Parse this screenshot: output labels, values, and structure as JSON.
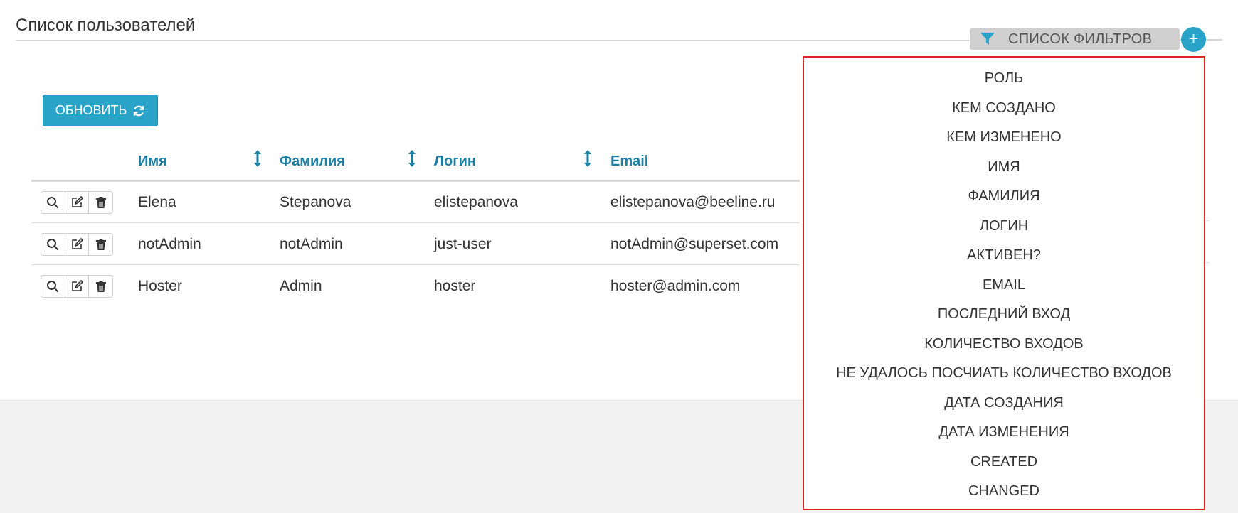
{
  "page": {
    "title": "Список пользователей"
  },
  "toolbar": {
    "refresh_label": "ОБНОВИТЬ"
  },
  "table": {
    "columns": [
      "Имя",
      "Фамилия",
      "Логин",
      "Email"
    ],
    "rows": [
      {
        "first_name": "Elena",
        "last_name": "Stepanova",
        "login": "elistepanova",
        "email": "elistepanova@beeline.ru"
      },
      {
        "first_name": "notAdmin",
        "last_name": "notAdmin",
        "login": "just-user",
        "email": "notAdmin@superset.com"
      },
      {
        "first_name": "Hoster",
        "last_name": "Admin",
        "login": "hoster",
        "email": "hoster@admin.com"
      }
    ]
  },
  "filters": {
    "header_label": "СПИСОК ФИЛЬТРОВ",
    "add_label": "+",
    "items": [
      "РОЛЬ",
      "КЕМ СОЗДАНО",
      "КЕМ ИЗМЕНЕНО",
      "ИМЯ",
      "ФАМИЛИЯ",
      "ЛОГИН",
      "АКТИВЕН?",
      "EMAIL",
      "ПОСЛЕДНИЙ ВХОД",
      "КОЛИЧЕСТВО ВХОДОВ",
      "НЕ УДАЛОСЬ ПОСЧИАТЬ КОЛИЧЕСТВО ВХОДОВ",
      "ДАТА СОЗДАНИЯ",
      "ДАТА ИЗМЕНЕНИЯ",
      "CREATED",
      "CHANGED"
    ]
  },
  "colors": {
    "accent": "#29a3c8",
    "header_text": "#1d7fa3",
    "highlight_border": "#e02424"
  }
}
